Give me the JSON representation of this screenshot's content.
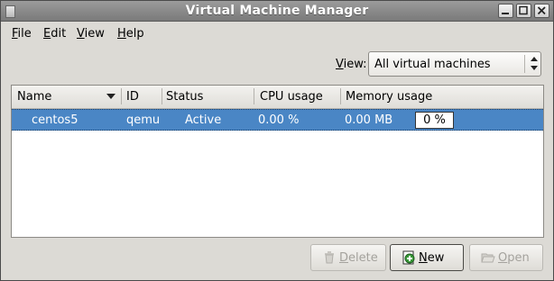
{
  "window": {
    "title": "Virtual Machine Manager"
  },
  "menubar": {
    "items": [
      {
        "label": "File",
        "mnemonic": "F",
        "rest": "ile"
      },
      {
        "label": "Edit",
        "mnemonic": "E",
        "rest": "dit"
      },
      {
        "label": "View",
        "mnemonic": "V",
        "rest": "iew"
      },
      {
        "label": "Help",
        "mnemonic": "H",
        "rest": "elp"
      }
    ]
  },
  "view_filter": {
    "label_mnemonic": "V",
    "label_rest": "iew:",
    "selected": "All virtual machines"
  },
  "table": {
    "columns": [
      "Name",
      "ID",
      "Status",
      "CPU usage",
      "Memory usage"
    ],
    "rows": [
      {
        "name": "centos5",
        "id": "qemu",
        "status": "Active",
        "cpu": "0.00 %",
        "memory": "0.00 MB",
        "memory_bar": "0 %",
        "selected": true
      }
    ]
  },
  "buttons": {
    "delete": {
      "mnemonic": "D",
      "rest": "elete",
      "enabled": false
    },
    "new": {
      "mnemonic": "N",
      "rest": "ew",
      "enabled": true
    },
    "open": {
      "mnemonic": "O",
      "rest": "pen",
      "enabled": false
    }
  },
  "colors": {
    "selection": "#4a86c5",
    "titlebar": "#8a8a8a",
    "window_bg": "#dcdad5"
  }
}
